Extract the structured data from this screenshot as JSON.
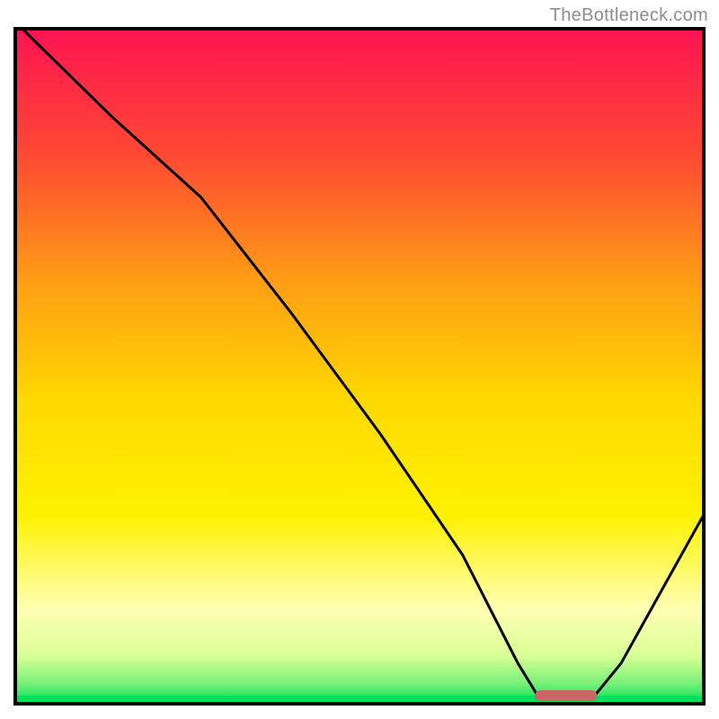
{
  "watermark": "TheBottleneck.com",
  "chart_data": {
    "type": "line",
    "title": "",
    "xlabel": "",
    "ylabel": "",
    "xlim": [
      0,
      100
    ],
    "ylim": [
      0,
      100
    ],
    "gradient_stops": [
      {
        "offset": 0,
        "color": "#ff1452"
      },
      {
        "offset": 18,
        "color": "#ff4634"
      },
      {
        "offset": 38,
        "color": "#ffa014"
      },
      {
        "offset": 55,
        "color": "#ffd800"
      },
      {
        "offset": 72,
        "color": "#fff200"
      },
      {
        "offset": 86,
        "color": "#ffffb4"
      },
      {
        "offset": 93,
        "color": "#d8ff96"
      },
      {
        "offset": 97,
        "color": "#78f078"
      },
      {
        "offset": 100,
        "color": "#00e05a"
      }
    ],
    "curve_points": [
      {
        "x": 1.0,
        "y": 100.0
      },
      {
        "x": 14.0,
        "y": 87.0
      },
      {
        "x": 27.0,
        "y": 75.0
      },
      {
        "x": 40.0,
        "y": 58.0
      },
      {
        "x": 53.0,
        "y": 40.0
      },
      {
        "x": 65.0,
        "y": 22.0
      },
      {
        "x": 73.0,
        "y": 6.0
      },
      {
        "x": 76.0,
        "y": 1.0
      },
      {
        "x": 84.0,
        "y": 1.0
      },
      {
        "x": 88.0,
        "y": 6.0
      },
      {
        "x": 100.0,
        "y": 28.0
      }
    ],
    "marker": {
      "x_start": 75.5,
      "x_end": 84.5,
      "y": 1.2,
      "color": "#cc6666"
    },
    "frame_color": "#000000",
    "curve_color": "#000000",
    "background_bottom_band_color": "#00e05a"
  }
}
